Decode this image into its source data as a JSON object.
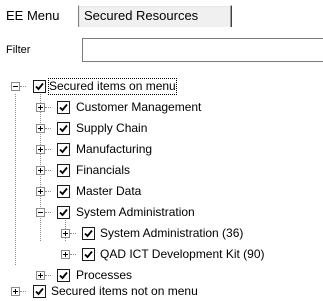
{
  "tabs": [
    {
      "label": "EE Menu",
      "active": true
    },
    {
      "label": "Secured Resources",
      "active": false
    }
  ],
  "filter": {
    "label": "Filter",
    "value": "",
    "placeholder": ""
  },
  "tree": {
    "root": {
      "label": "Secured items on menu",
      "checked": true,
      "expanded": true
    },
    "root_children": [
      {
        "label": "Customer Management",
        "checked": true,
        "expanded": false
      },
      {
        "label": "Supply Chain",
        "checked": true,
        "expanded": false
      },
      {
        "label": "Manufacturing",
        "checked": true,
        "expanded": false
      },
      {
        "label": "Financials",
        "checked": true,
        "expanded": false
      },
      {
        "label": "Master Data",
        "checked": true,
        "expanded": false
      },
      {
        "label": "System Administration",
        "checked": true,
        "expanded": true
      },
      {
        "label": "Processes",
        "checked": true,
        "expanded": false
      }
    ],
    "sysadmin_children": [
      {
        "label": "System Administration (36)",
        "checked": true,
        "expanded": false
      },
      {
        "label": "QAD ICT Development Kit (90)",
        "checked": true,
        "expanded": false
      }
    ],
    "root2": {
      "label": "Secured items not on menu",
      "checked": true,
      "expanded": false
    }
  }
}
